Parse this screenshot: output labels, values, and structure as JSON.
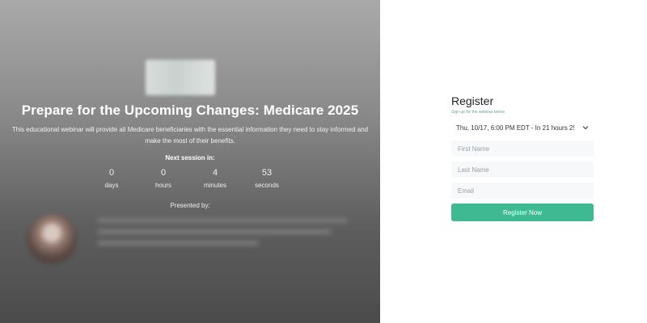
{
  "event": {
    "title": "Prepare for the Upcoming Changes: Medicare 2025",
    "description": "This educational webinar will provide all Medicare beneficiaries with the essential information they need to stay informed and make the most of their benefits.",
    "next_session_label": "Next session in:",
    "countdown": [
      {
        "value": "0",
        "unit": "days"
      },
      {
        "value": "0",
        "unit": "hours"
      },
      {
        "value": "4",
        "unit": "minutes"
      },
      {
        "value": "53",
        "unit": "seconds"
      }
    ],
    "presented_by_label": "Presented by:"
  },
  "register": {
    "title": "Register",
    "subtitle": "Sign up for the webinar below",
    "session_value": "Thu, 10/17, 6:00 PM EDT - In 21 hours 2!",
    "first_name_placeholder": "First Name",
    "last_name_placeholder": "Last Name",
    "email_placeholder": "Email",
    "button_label": "Register Now"
  },
  "colors": {
    "accent": "#3dba91",
    "subtitle": "#6f9fa0"
  },
  "icons": {
    "session_dropdown": "chevron-down-icon"
  }
}
